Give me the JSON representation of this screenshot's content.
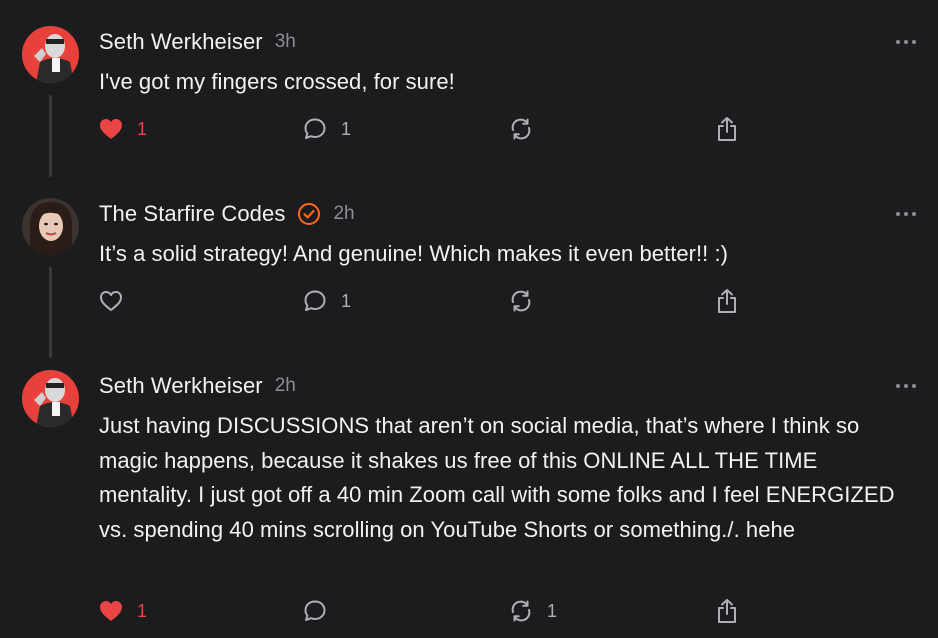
{
  "comments": [
    {
      "author": "Seth Werkheiser",
      "time": "3h",
      "verified": false,
      "text": "I've got my fingers crossed, for sure!",
      "likes": "1",
      "liked": true,
      "replies": "1",
      "restacks": "",
      "avatar": "person-avatar-red"
    },
    {
      "author": "The Starfire Codes",
      "time": "2h",
      "verified": true,
      "text": "It’s a solid strategy! And genuine! Which makes it even better!! :)",
      "likes": "",
      "liked": false,
      "replies": "1",
      "restacks": "",
      "avatar": "person-avatar-dark"
    },
    {
      "author": "Seth Werkheiser",
      "time": "2h",
      "verified": false,
      "text": "Just having DISCUSSIONS that aren’t on social media, that’s where I think so magic happens, because it shakes us free of this ONLINE ALL THE TIME mentality. I just got off a 40 min Zoom call with some folks and I feel ENERGIZED vs. spending 40 mins scrolling on YouTube Shorts or something./. hehe",
      "likes": "1",
      "liked": true,
      "replies": "",
      "restacks": "1",
      "avatar": "person-avatar-red"
    }
  ],
  "icons": {
    "like": "heart-icon",
    "reply": "speech-bubble-icon",
    "restack": "restack-icon",
    "share": "share-icon",
    "more": "ellipsis-icon",
    "verified": "verified-check-icon"
  },
  "colors": {
    "background": "#1c1c1e",
    "text": "#f2f2f2",
    "muted": "#8e8e93",
    "like": "#ea4444",
    "verified": "#ff6719",
    "avatar_red": "#e8413c"
  }
}
